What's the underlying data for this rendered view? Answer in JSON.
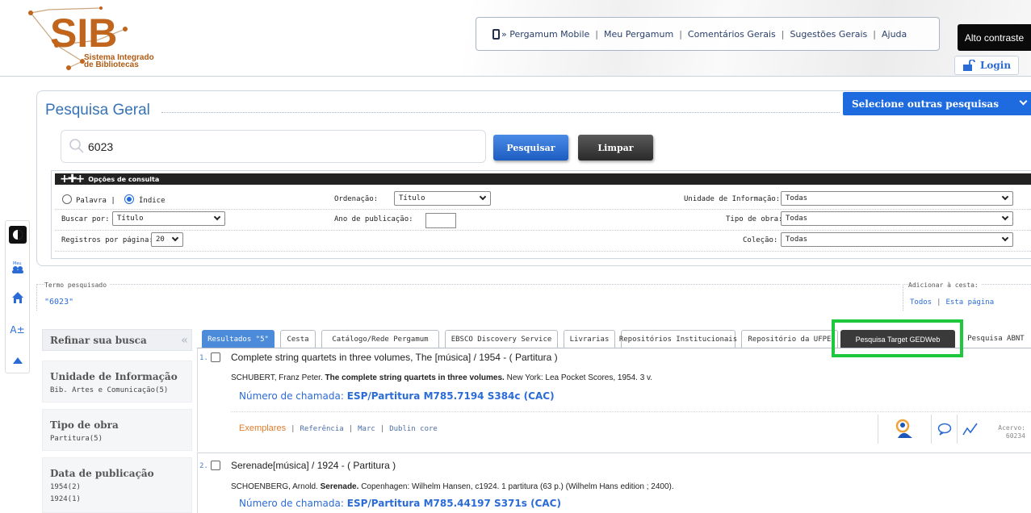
{
  "header": {
    "logo_text_line1": "Sistema Integrado",
    "logo_text_line2": "de Bibliotecas",
    "links": [
      "» Pergamum Mobile",
      "Meu Pergamum",
      "Comentários Gerais",
      "Sugestões Gerais",
      "Ajuda"
    ],
    "contrast_label": "Alto contraste",
    "login_label": "Login"
  },
  "side_tools": {
    "meu_label": "Meu",
    "font_label": "A±"
  },
  "search": {
    "title": "Pesquisa Geral",
    "other_search_label": "Selecione outras pesquisas",
    "query_value": "6023",
    "search_button": "Pesquisar",
    "clear_button": "Limpar",
    "options_label": "Opções de consulta",
    "radio_palavra": "Palavra",
    "radio_indice": "Índice",
    "ordenacao_label": "Ordenação:",
    "ordenacao_value": "Título",
    "unidade_label": "Unidade de Informação:",
    "unidade_value": "Todas",
    "buscar_por_label": "Buscar por:",
    "buscar_por_value": "Título",
    "ano_label": "Ano de publicação:",
    "tipo_obra_label": "Tipo de obra:",
    "tipo_obra_value": "Todas",
    "registros_label": "Registros por página:",
    "registros_value": "20",
    "colecao_label": "Coleção:",
    "colecao_value": "Todas"
  },
  "term": {
    "label": "Termo pesquisado",
    "value": "\"6023\"",
    "cart_label": "Adicionar à cesta:",
    "cart_all": "Todos",
    "cart_page": "Esta página"
  },
  "refine": {
    "title": "Refinar sua busca",
    "facets": [
      {
        "title": "Unidade de Informação",
        "items": [
          "Bib. Artes e Comunicação(5)"
        ]
      },
      {
        "title": "Tipo de obra",
        "items": [
          "Partitura(5)"
        ]
      },
      {
        "title": "Data de publicação",
        "items": [
          "1954(2)",
          "1924(1)"
        ]
      }
    ]
  },
  "tabs": [
    "Resultados \"5\"",
    "Cesta",
    "Catálogo/Rede Pergamum",
    "EBSCO Discovery Service",
    "Livrarias",
    "Repositórios Institucionais",
    "Repositório da UFPE",
    "Pesquisa Target GEDWeb",
    "Pesquisa ABNT"
  ],
  "results": [
    {
      "num": "1.",
      "title": "Complete string quartets in three volumes, The [música] / 1954 -  ( Partitura )",
      "ref_author": "SCHUBERT, Franz Peter.",
      "ref_title": "The complete string quartets in three volumes.",
      "ref_rest": "New York: Lea Pocket Scores, 1954. 3 v.",
      "call_label": "Número de chamada:",
      "call_value": "ESP/Partitura M785.7194 S384c (CAC)",
      "actions": [
        "Exemplares",
        "Referência",
        "Marc",
        "Dublin core"
      ],
      "acervo_label": "Acervo:",
      "acervo_value": "60234"
    },
    {
      "num": "2.",
      "title": "Serenade[música] / 1924 -  ( Partitura )",
      "ref_author": "SCHOENBERG, Arnold.",
      "ref_title": "Serenade.",
      "ref_rest": "Copenhagen: Wilhelm Hansen, c1924. 1 partitura (63 p.) (Wilhelm Hans edition ; 2400).",
      "call_label": "Número de chamada:",
      "call_value": "ESP/Partitura M785.44197 S371s (CAC)"
    }
  ],
  "colors": {
    "accent_blue": "#1e6be0",
    "link_blue": "#2a6bd6",
    "highlight_green": "#1fc73d",
    "logo_orange": "#c0651b"
  }
}
